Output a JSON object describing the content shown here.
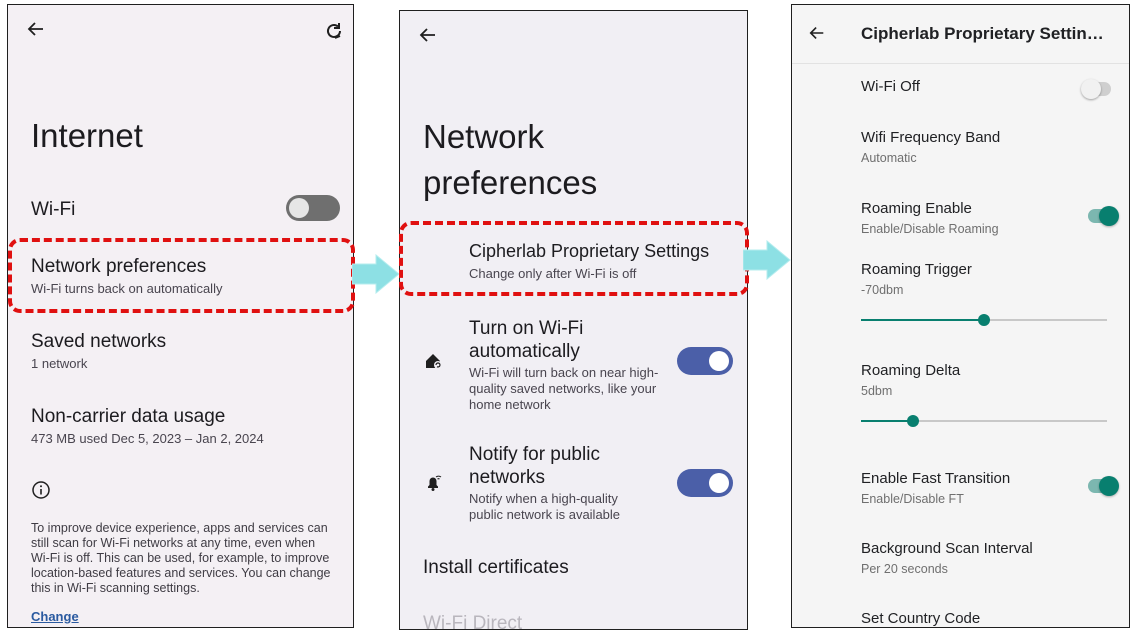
{
  "colors": {
    "accent_red": "#e01010",
    "toggle_on": "#4b5fa8",
    "teal": "#087f6f",
    "arrow_fill": "#8de0e4"
  },
  "panel1": {
    "back_icon": "arrow-left-icon",
    "refresh_icon": "refresh-icon",
    "title": "Internet",
    "wifi_label": "Wi-Fi",
    "wifi_on": false,
    "net_pref_title": "Network preferences",
    "net_pref_sub": "Wi-Fi turns back on automatically",
    "saved_title": "Saved networks",
    "saved_sub": "1 network",
    "noncarrier_title": "Non-carrier data usage",
    "noncarrier_sub": "473 MB used Dec 5, 2023 – Jan 2, 2024",
    "info_icon": "info-icon",
    "info_text": "To improve device experience, apps and services can still scan for Wi-Fi networks at any time, even when Wi-Fi is off. This can be used, for example, to improve location-based features and services. You can change this in Wi-Fi scanning settings.",
    "change_link": "Change"
  },
  "panel2": {
    "back_icon": "arrow-left-icon",
    "title_line1": "Network",
    "title_line2": "preferences",
    "cipher_title": "Cipherlab Proprietary Settings",
    "cipher_sub": "Change only after Wi-Fi is off",
    "turn_on_title_1": "Turn on Wi-Fi",
    "turn_on_title_2": "automatically",
    "turn_on_sub": "Wi-Fi will turn back on near high-quality saved networks, like your home network",
    "turn_on_enabled": true,
    "notify_title_1": "Notify for public",
    "notify_title_2": "networks",
    "notify_sub": "Notify when a high-quality public network is available",
    "notify_enabled": true,
    "install_certs": "Install certificates",
    "wifi_direct": "Wi-Fi Direct"
  },
  "panel3": {
    "back_icon": "arrow-left-icon",
    "title": "Cipherlab Proprietary Settin…",
    "wifi_off_label": "Wi-Fi Off",
    "wifi_off_on": false,
    "freq_title": "Wifi Frequency Band",
    "freq_sub": "Automatic",
    "roam_enable_title": "Roaming Enable",
    "roam_enable_sub": "Enable/Disable Roaming",
    "roam_enable_on": true,
    "roam_trigger_title": "Roaming Trigger",
    "roam_trigger_sub": "-70dbm",
    "roam_trigger_level": 0.5,
    "roam_delta_title": "Roaming Delta",
    "roam_delta_sub": "5dbm",
    "roam_delta_level": 0.21,
    "fast_title": "Enable Fast Transition",
    "fast_sub": "Enable/Disable FT",
    "fast_on": true,
    "bg_scan_title": "Background Scan Interval",
    "bg_scan_sub": "Per 20 seconds",
    "country_title": "Set Country Code"
  }
}
